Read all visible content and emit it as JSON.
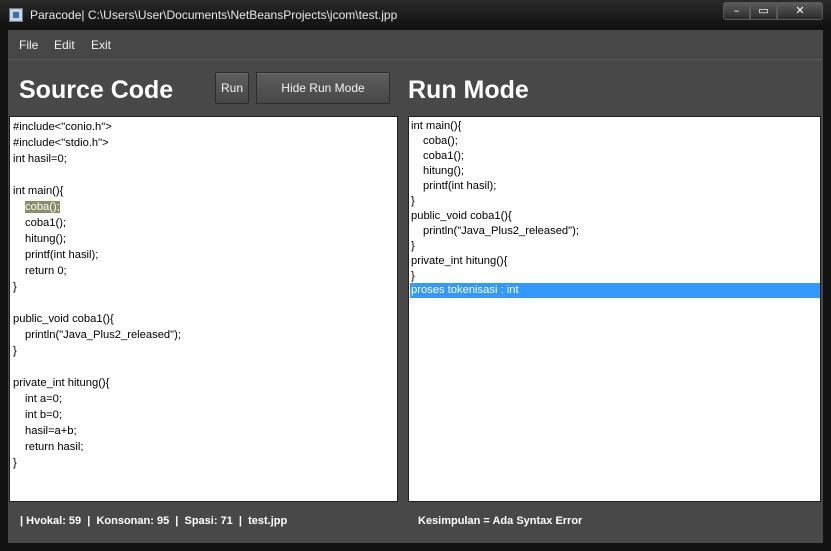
{
  "window": {
    "title": "Paracode| C:\\Users\\User\\Documents\\NetBeansProjects\\jcom\\test.jpp",
    "minimize_glyph": "–",
    "maximize_glyph": "▭",
    "close_glyph": "✕"
  },
  "menu": {
    "file": "File",
    "edit": "Edit",
    "exit": "Exit"
  },
  "source": {
    "heading": "Source Code"
  },
  "toolbar": {
    "run_label": "Run",
    "hide_run_label": "Hide Run Mode"
  },
  "run_mode": {
    "heading": "Run Mode"
  },
  "source_code": {
    "l1": "#include<\"conio.h\">",
    "l2": "#include<\"stdio.h\">",
    "l3": "int hasil=0;",
    "l5": "int main(){",
    "l6": "coba();",
    "l7": "coba1();",
    "l8": "hitung();",
    "l9": "printf(int hasil);",
    "l10": "return 0;",
    "l11": "}",
    "l13": "public_void coba1(){",
    "l14": "println(\"Java_Plus2_released\");",
    "l15": "}",
    "l17": "private_int hitung(){",
    "l18": "int a=0;",
    "l19": "int b=0;",
    "l20": "hasil=a+b;",
    "l21": "return hasil;",
    "l22": "}"
  },
  "run_output": {
    "l1": "int main(){",
    "l2": "coba();",
    "l3": "coba1();",
    "l4": "hitung();",
    "l5": "printf(int hasil);",
    "l6": "}",
    "l7": "public_void coba1(){",
    "l8": "println(\"Java_Plus2_released\");",
    "l9": "}",
    "l10": "private_int hitung(){",
    "l11": "}",
    "l12": "proses tokenisasi : int"
  },
  "status": {
    "stats": "| Hvokal: 59  |  Konsonan: 95  |  Spasi: 71  |  test.jpp",
    "conclusion": "Kesimpulan = Ada Syntax Error"
  },
  "colors": {
    "panel_bg": "#484848",
    "selection": "#3399ff",
    "highlight": "#8c8c6a"
  }
}
